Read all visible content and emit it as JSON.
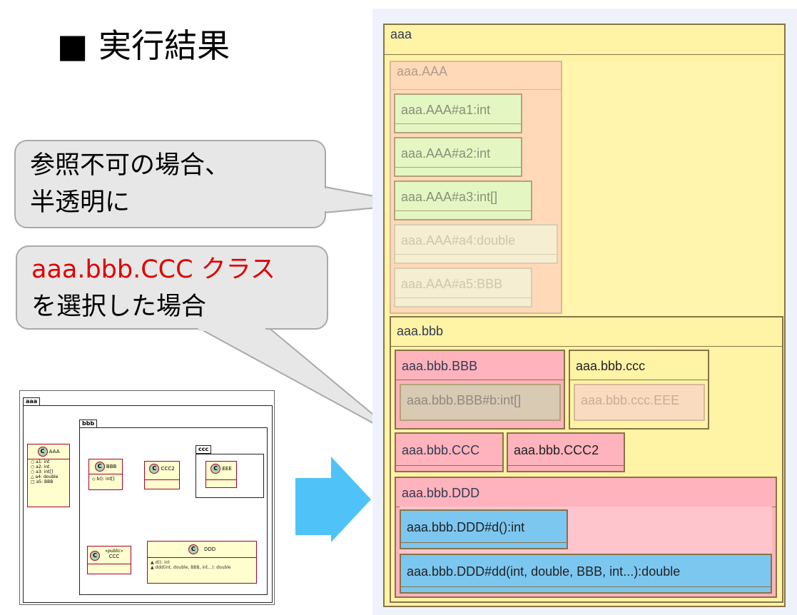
{
  "title": "■ 実行結果",
  "bubble1": {
    "line1": "参照不可の場合、",
    "line2": "半透明に"
  },
  "bubble2": {
    "line1_red": "aaa.bbb.CCC クラス",
    "line2": "を選択した場合"
  },
  "thumbnail": {
    "pkg_aaa": "aaa",
    "pkg_bbb": "bbb",
    "pkg_ccc": "ccc",
    "class_AAA": {
      "name": "AAA",
      "attrs": [
        "○ a1: int",
        "○ a2: int",
        "○ a3: int[]",
        "△ a4: double",
        "□ a5: BBB"
      ]
    },
    "class_BBB": {
      "name": "BBB",
      "attrs": [
        "◇ b(): int[]"
      ]
    },
    "class_CCC2": {
      "name": "CCC2"
    },
    "class_EEE": {
      "name": "EEE"
    },
    "class_CCC": {
      "stereotype": "«public»",
      "name": "CCC"
    },
    "class_DDD": {
      "name": "DDD",
      "attrs": [
        "▲ d(): int",
        "▲ ddd(int, double, BBB, int...): double"
      ]
    },
    "glyph_c": "C"
  },
  "colors": {
    "arrow": "#4fc3f7",
    "aaa": "#fff3a6",
    "AAA": "#ffd9b8",
    "field_green": "#e4f7c2",
    "pink": "#ffb3bd",
    "blue": "#7cc7f0",
    "red_text": "#e00000"
  },
  "boxes": {
    "aaa": "aaa",
    "aaa_AAA": "aaa.AAA",
    "a1": "aaa.AAA#a1:int",
    "a2": "aaa.AAA#a2:int",
    "a3": "aaa.AAA#a3:int[]",
    "a4": "aaa.AAA#a4:double",
    "a5": "aaa.AAA#a5:BBB",
    "aaa_bbb": "aaa.bbb",
    "BBB": "aaa.bbb.BBB",
    "BBB_b": "aaa.bbb.BBB#b:int[]",
    "ccc": "aaa.bbb.ccc",
    "EEE": "aaa.bbb.ccc.EEE",
    "CCC": "aaa.bbb.CCC",
    "CCC2": "aaa.bbb.CCC2",
    "DDD": "aaa.bbb.DDD",
    "DDD_d": "aaa.bbb.DDD#d():int",
    "DDD_dd": "aaa.bbb.DDD#dd(int, double, BBB, int...):double"
  }
}
